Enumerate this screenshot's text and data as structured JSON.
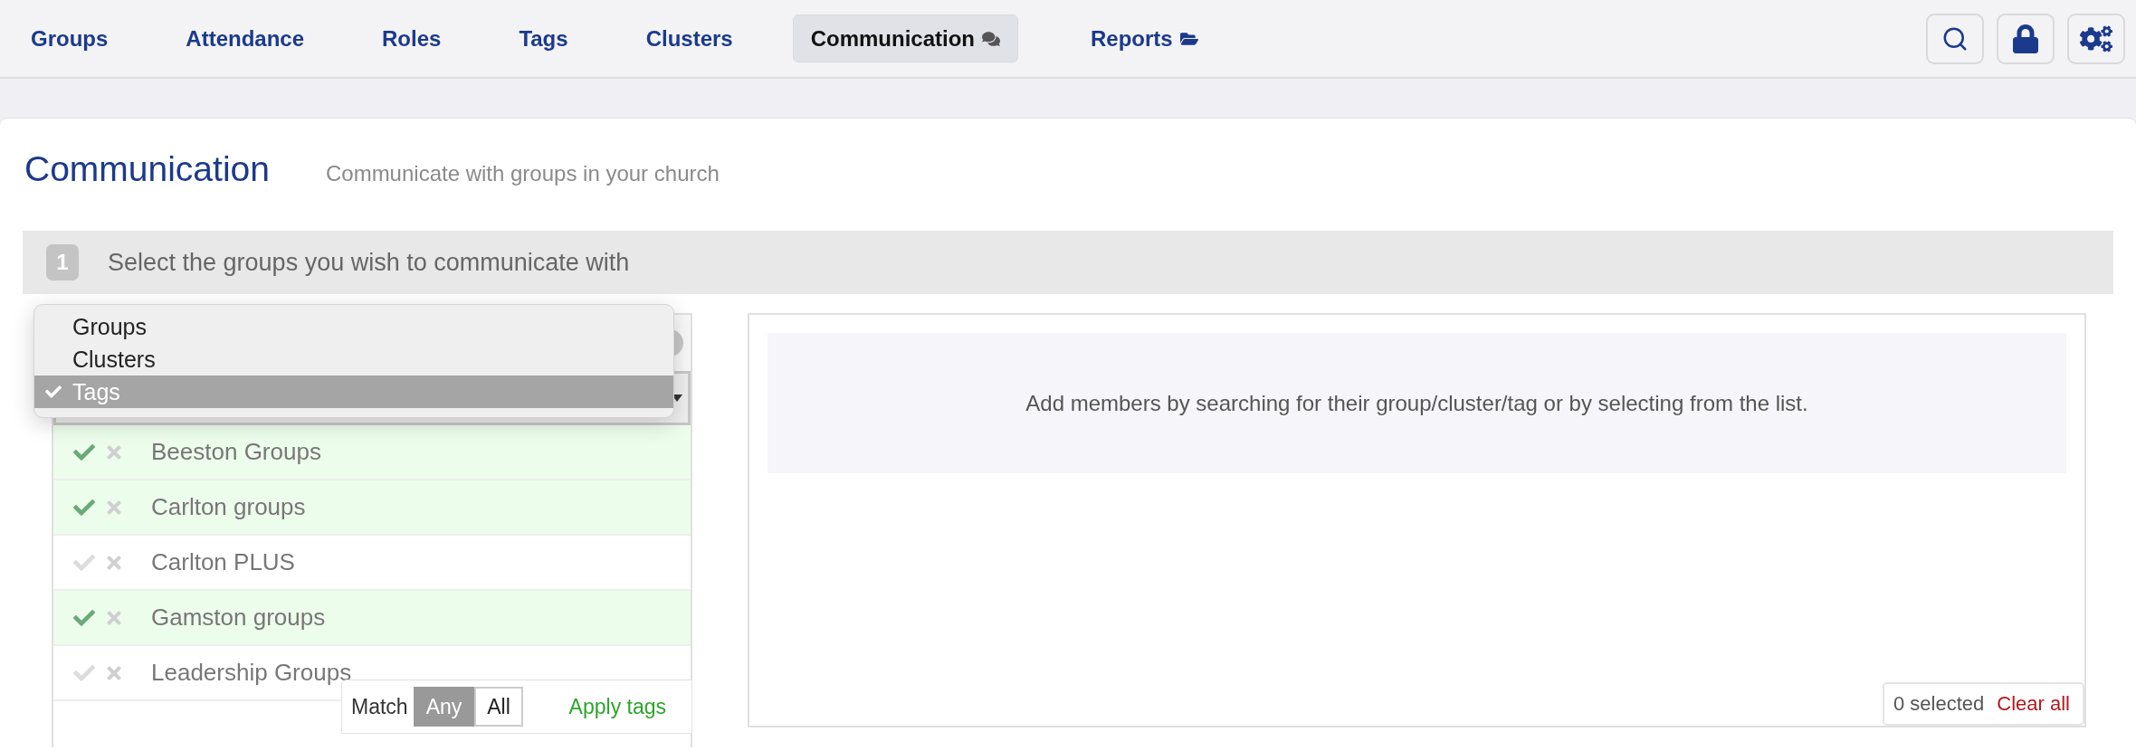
{
  "nav": {
    "items": [
      {
        "label": "Groups",
        "selected": false
      },
      {
        "label": "Attendance",
        "selected": false
      },
      {
        "label": "Roles",
        "selected": false
      },
      {
        "label": "Tags",
        "selected": false
      },
      {
        "label": "Clusters",
        "selected": false
      },
      {
        "label": "Communication",
        "selected": true,
        "kind": "comments"
      },
      {
        "label": "Reports",
        "selected": false,
        "kind": "folder"
      }
    ],
    "tools": [
      {
        "kind": "search"
      },
      {
        "kind": "lock"
      },
      {
        "kind": "settings"
      }
    ]
  },
  "page": {
    "title": "Communication",
    "subtitle": "Communicate with groups in your church"
  },
  "step": {
    "number": "1",
    "text": "Select the groups you wish to communicate with"
  },
  "type_menu": {
    "options": [
      {
        "label": "Groups",
        "selected": false
      },
      {
        "label": "Clusters",
        "selected": false
      },
      {
        "label": "Tags",
        "selected": true
      }
    ]
  },
  "tag_list": [
    {
      "name": "Beeston Groups",
      "included": true
    },
    {
      "name": "Carlton groups",
      "included": true
    },
    {
      "name": "Carlton PLUS",
      "included": false
    },
    {
      "name": "Gamston groups",
      "included": true
    },
    {
      "name": "Leadership Groups",
      "included": false
    }
  ],
  "match_bar": {
    "label": "Match",
    "options": [
      {
        "label": "Any",
        "selected": true
      },
      {
        "label": "All",
        "selected": false
      }
    ],
    "apply": "Apply tags"
  },
  "members": {
    "hint": "Add members by searching for their group/cluster/tag or by selecting from the list.",
    "count": "0 selected",
    "clear": "Clear all"
  }
}
